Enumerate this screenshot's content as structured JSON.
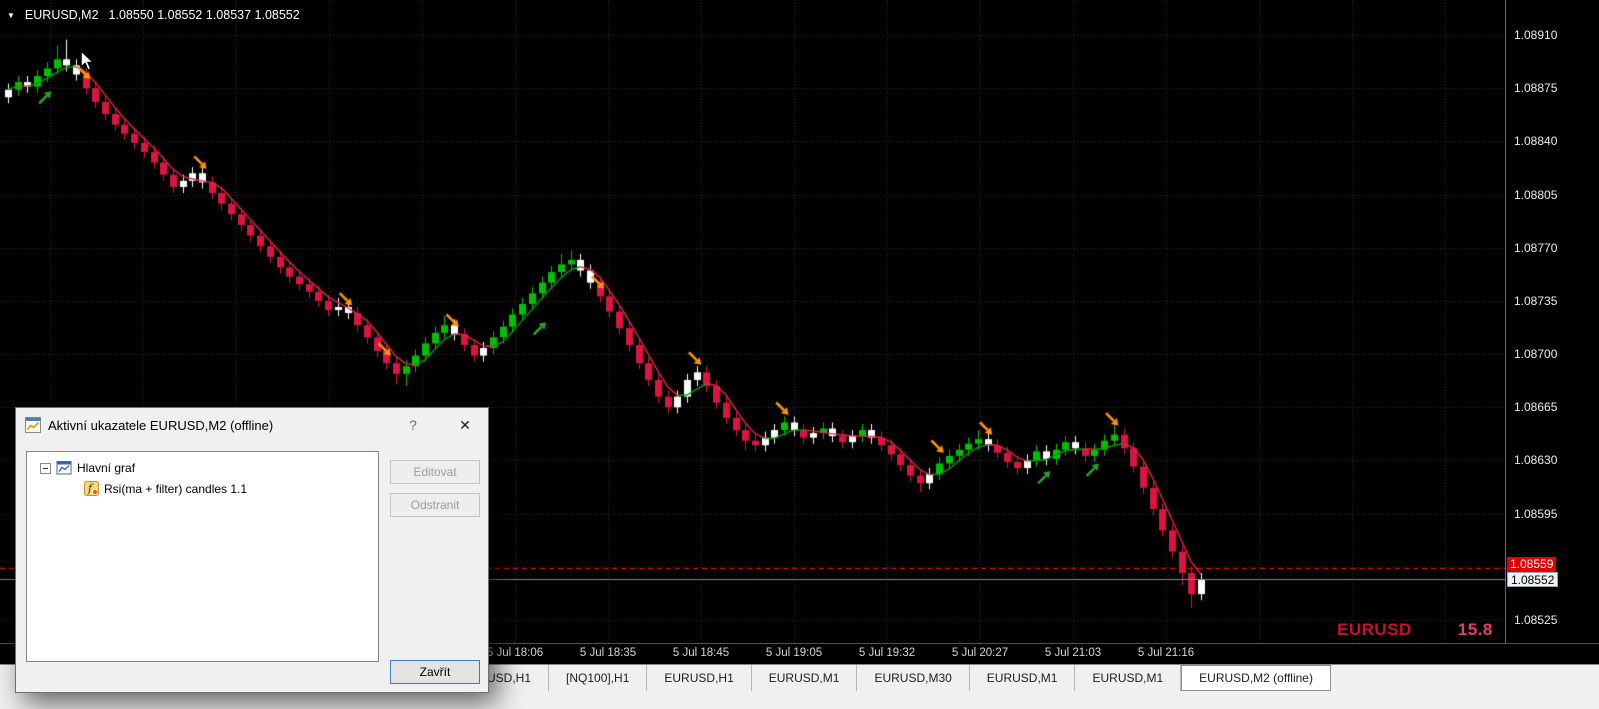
{
  "colors": {
    "background": "#000000",
    "grid": "#303030",
    "candle_up": "#00c000",
    "candle_down": "#dc1440",
    "candle_flat": "#ffffff",
    "ma_up": "#00a000",
    "ma_down": "#e8244e",
    "arrow_up": "#2e9e2e",
    "arrow_down": "#ff9500",
    "ask_line": "#ff0000",
    "bid_line": "#7d8ca0",
    "ask_box_bg": "#e00000",
    "watermark_symbol": "#c8102e",
    "watermark_value": "#ea3a6c"
  },
  "quote_bar": {
    "marker": "▼",
    "symbol": "EURUSD,M2",
    "ohlc": "1.08550 1.08552 1.08537 1.08552"
  },
  "watermark": {
    "symbol": "EURUSD",
    "value": "15.8"
  },
  "chart_data": {
    "type": "candlestick",
    "title": "EURUSD,M2 (offline)",
    "symbol": "EURUSD",
    "timeframe": "M2 (offline)",
    "price_range": {
      "top": 1.0891,
      "bottom": 1.08525,
      "step": 0.00035
    },
    "price_axis": {
      "labels": [
        "1.08910",
        "1.08875",
        "1.08840",
        "1.08805",
        "1.08770",
        "1.08735",
        "1.08700",
        "1.08665",
        "1.08630",
        "1.08595",
        "1.08525"
      ],
      "ask": {
        "price": 1.08559,
        "label": "1.08559"
      },
      "bid": {
        "price": 1.08552,
        "label": "1.08552"
      }
    },
    "time_axis": {
      "labels": [
        "5 Jul 18:06",
        "5 Jul 18:35",
        "5 Jul 18:45",
        "5 Jul 19:05",
        "5 Jul 19:32",
        "5 Jul 20:27",
        "5 Jul 21:03",
        "5 Jul 21:16"
      ]
    },
    "candles": {
      "first_open": 1.08869,
      "wick": 4e-05,
      "closes": [
        1.08874,
        1.08879,
        1.08876,
        1.08883,
        1.08888,
        1.08894,
        1.0889,
        1.08884,
        1.08875,
        1.08866,
        1.08858,
        1.08851,
        1.08845,
        1.08839,
        1.08833,
        1.08826,
        1.08818,
        1.0881,
        1.08814,
        1.08819,
        1.08813,
        1.08806,
        1.08799,
        1.08792,
        1.08785,
        1.08778,
        1.08771,
        1.08764,
        1.08757,
        1.08751,
        1.08746,
        1.08741,
        1.08735,
        1.08729,
        1.08731,
        1.08727,
        1.08719,
        1.08711,
        1.08702,
        1.08694,
        1.08687,
        1.08692,
        1.08699,
        1.08707,
        1.08714,
        1.08719,
        1.08713,
        1.08706,
        1.08699,
        1.08704,
        1.08711,
        1.08718,
        1.08726,
        1.08733,
        1.0874,
        1.08747,
        1.08754,
        1.08759,
        1.08762,
        1.08755,
        1.08747,
        1.08738,
        1.08728,
        1.08717,
        1.08706,
        1.08694,
        1.08683,
        1.08672,
        1.08665,
        1.08672,
        1.08683,
        1.08688,
        1.08679,
        1.08668,
        1.08658,
        1.0865,
        1.08643,
        1.0864,
        1.08645,
        1.0865,
        1.08655,
        1.0865,
        1.08645,
        1.08648,
        1.08651,
        1.08646,
        1.08642,
        1.08646,
        1.0865,
        1.08645,
        1.0864,
        1.08634,
        1.08627,
        1.0862,
        1.08615,
        1.08621,
        1.08628,
        1.08633,
        1.08637,
        1.08641,
        1.08644,
        1.0864,
        1.08635,
        1.08629,
        1.08625,
        1.0863,
        1.08636,
        1.08631,
        1.08637,
        1.08642,
        1.08638,
        1.08633,
        1.08637,
        1.08643,
        1.08647,
        1.08638,
        1.08626,
        1.08612,
        1.08598,
        1.08584,
        1.0857,
        1.08556,
        1.08542,
        1.08552
      ],
      "colors": "wgwgggwwrrrrrrrrrrwwwrrrrrrrrrrrrrwwrrrrrgggggwrrwgggggggggwwrrrrrrrrwwwrrrrrrwwgwrwgwrwgwrrrrrwgggggwrrrwgwggwrgggrrrrrrrrw",
      "high_overrides": {
        "5": 1.08903,
        "6": 1.08907,
        "34": 1.08737,
        "45": 1.08725,
        "57": 1.08766,
        "58": 1.08768,
        "100": 1.0865,
        "114": 1.08654
      },
      "low_overrides": {
        "40": 1.0868,
        "41": 1.08679,
        "76": 1.08637,
        "77": 1.08636,
        "94": 1.08609,
        "121": 1.08548,
        "122": 1.08533
      }
    },
    "signals": [
      {
        "i": 4,
        "dir": "up",
        "price": 1.0887
      },
      {
        "i": 8,
        "dir": "down",
        "price": 1.08884
      },
      {
        "i": 20,
        "dir": "down",
        "price": 1.08825
      },
      {
        "i": 35,
        "dir": "down",
        "price": 1.08735
      },
      {
        "i": 39,
        "dir": "down",
        "price": 1.08702
      },
      {
        "i": 46,
        "dir": "down",
        "price": 1.08721
      },
      {
        "i": 55,
        "dir": "up",
        "price": 1.08718
      },
      {
        "i": 61,
        "dir": "down",
        "price": 1.08746
      },
      {
        "i": 71,
        "dir": "down",
        "price": 1.08696
      },
      {
        "i": 80,
        "dir": "down",
        "price": 1.08663
      },
      {
        "i": 96,
        "dir": "down",
        "price": 1.08638
      },
      {
        "i": 101,
        "dir": "down",
        "price": 1.0865
      },
      {
        "i": 107,
        "dir": "up",
        "price": 1.0862
      },
      {
        "i": 112,
        "dir": "up",
        "price": 1.08625
      },
      {
        "i": 114,
        "dir": "down",
        "price": 1.08656
      }
    ]
  },
  "dialog": {
    "title": "Aktivní ukazatele EURUSD,M2 (offline)",
    "help_label": "?",
    "close_glyph": "✕",
    "tree": {
      "root": "Hlavní graf",
      "child": "Rsi(ma + filter) candles 1.1"
    },
    "buttons": {
      "edit": "Editovat",
      "remove": "Odstranit",
      "close": "Zavřít"
    }
  },
  "tabbar": {
    "tabs": [
      {
        "label": "USD,H1"
      },
      {
        "label": "[NQ100],H1"
      },
      {
        "label": "EURUSD,H1"
      },
      {
        "label": "EURUSD,M1"
      },
      {
        "label": "EURUSD,M30"
      },
      {
        "label": "EURUSD,M1"
      },
      {
        "label": "EURUSD,M1"
      },
      {
        "label": "EURUSD,M2 (offline)",
        "active": true
      }
    ]
  }
}
